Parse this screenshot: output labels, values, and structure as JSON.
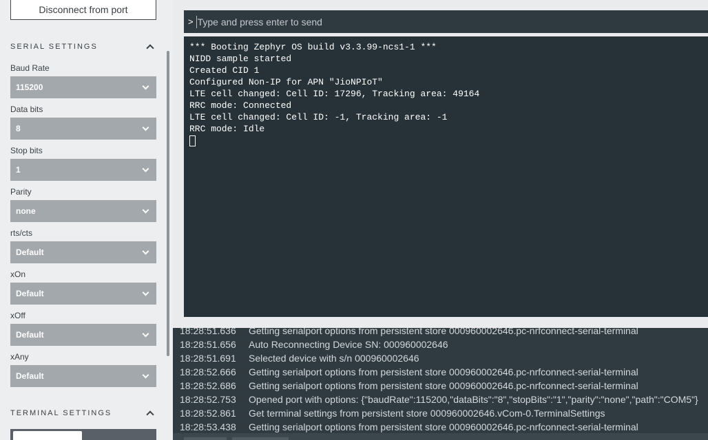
{
  "sidebar": {
    "disconnect_label": "Disconnect from port",
    "serial_settings_title": "SERIAL SETTINGS",
    "terminal_settings_title": "TERMINAL SETTINGS",
    "fields": [
      {
        "label": "Baud Rate",
        "value": "115200"
      },
      {
        "label": "Data bits",
        "value": "8"
      },
      {
        "label": "Stop bits",
        "value": "1"
      },
      {
        "label": "Parity",
        "value": "none"
      },
      {
        "label": "rts/cts",
        "value": "Default"
      },
      {
        "label": "xOn",
        "value": "Default"
      },
      {
        "label": "xOff",
        "value": "Default"
      },
      {
        "label": "xAny",
        "value": "Default"
      }
    ]
  },
  "terminal": {
    "prompt": ">",
    "input_placeholder": "Type and press enter to send",
    "lines": [
      "*** Booting Zephyr OS build v3.3.99-ncs1-1 ***",
      "NIDD sample started",
      "Created CID 1",
      "Configured Non-IP for APN \"JioNPIoT\"",
      "LTE cell changed: Cell ID: 17296, Tracking area: 49164",
      "RRC mode: Connected",
      "LTE cell changed: Cell ID: -1, Tracking area: -1",
      "RRC mode: Idle"
    ]
  },
  "log": [
    {
      "time": "18:28:51.636",
      "message": "Getting serialport options from persistent store 000960002646.pc-nrfconnect-serial-terminal"
    },
    {
      "time": "18:28:51.656",
      "message": "Auto Reconnecting Device SN: 000960002646"
    },
    {
      "time": "18:28:51.691",
      "message": "Selected device with s/n 000960002646"
    },
    {
      "time": "18:28:52.666",
      "message": "Getting serialport options from persistent store 000960002646.pc-nrfconnect-serial-terminal"
    },
    {
      "time": "18:28:52.686",
      "message": "Getting serialport options from persistent store 000960002646.pc-nrfconnect-serial-terminal"
    },
    {
      "time": "18:28:52.753",
      "message": "Opened port with options: {\"baudRate\":115200,\"dataBits\":\"8\",\"stopBits\":\"1\",\"parity\":\"none\",\"path\":\"COM5\"}"
    },
    {
      "time": "18:28:52.861",
      "message": "Get terminal settings from persistent store 000960002646.vCom-0.TerminalSettings"
    },
    {
      "time": "18:28:53.438",
      "message": "Getting serialport options from persistent store 000960002646.pc-nrfconnect-serial-terminal"
    }
  ]
}
